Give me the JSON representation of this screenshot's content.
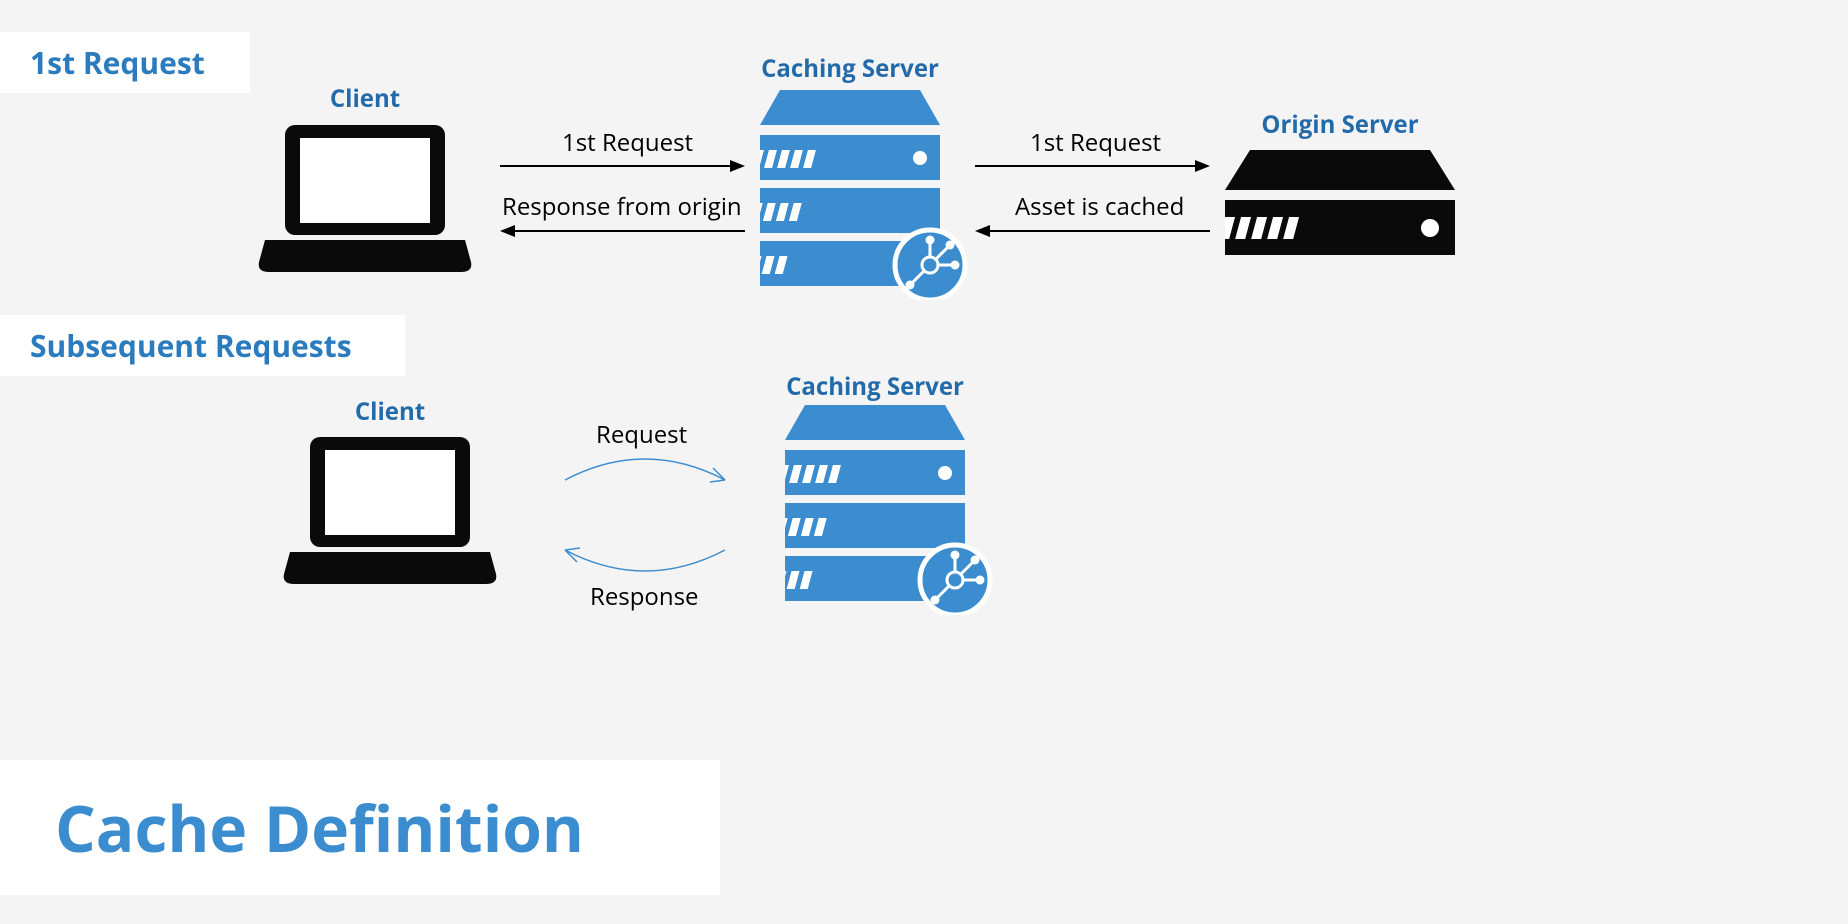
{
  "sections": {
    "first": "1st Request",
    "subsequent": "Subsequent Requests"
  },
  "title": "Cache Definition",
  "labels": {
    "client": "Client",
    "caching_server": "Caching Server",
    "origin_server": "Origin Server"
  },
  "arrows": {
    "first_request": "1st Request",
    "response_from_origin": "Response from origin",
    "asset_is_cached": "Asset is cached",
    "request": "Request",
    "response": "Response"
  },
  "colors": {
    "blue": "#3c8dcf",
    "dark_blue": "#236aaa",
    "black": "#0a0a0a"
  }
}
